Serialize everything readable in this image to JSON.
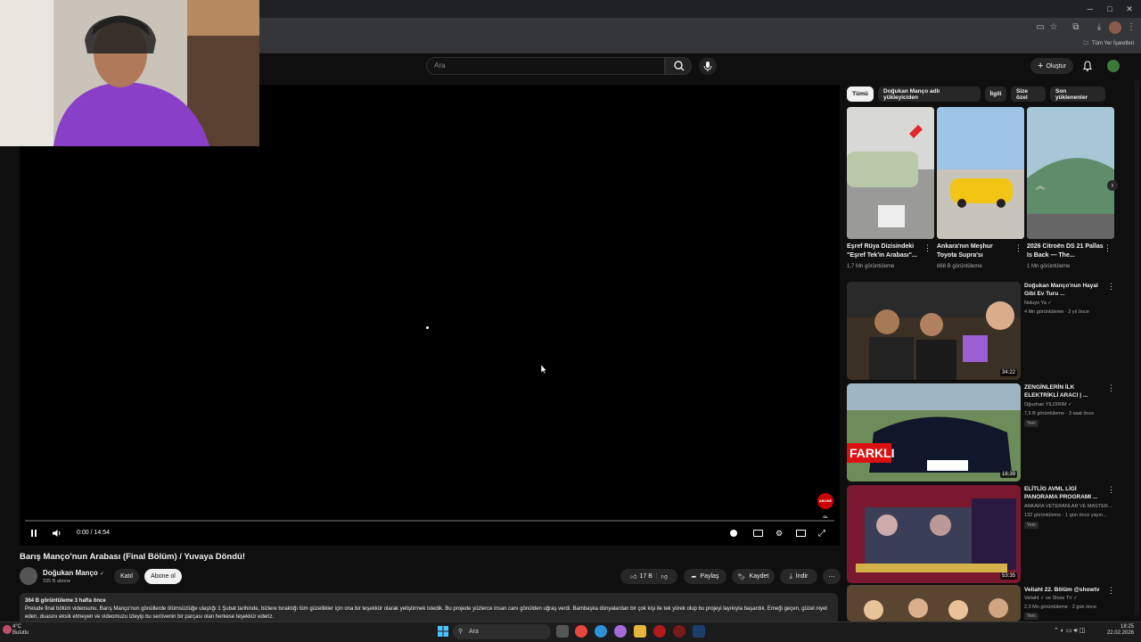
{
  "browser": {
    "bookmarks_label": "Tüm Yer İşaretleri"
  },
  "header": {
    "search_placeholder": "Ara",
    "create_label": "Oluştur"
  },
  "player": {
    "time": "0:00 / 14:54",
    "progress": 0,
    "badge": "ABONE OL"
  },
  "video": {
    "title": "Barış Manço'nun Arabası (Final Bölüm) / Yuvaya Döndü!",
    "channel": "Doğukan Manço",
    "subscribers": "335 B abone",
    "join_label": "Katıl",
    "subscribe_label": "Abone ol",
    "likes": "17 B",
    "share_label": "Paylaş",
    "save_label": "Kaydet",
    "download_label": "İndir",
    "desc_stats": "364 B görüntüleme  3 hafta önce",
    "desc_text": "Prelude final bölüm videosunu, Barış Manço'nun gönüllerde ölümsüzlüğe ulaştığı 1 Şubat tarihinde,  bizlere bıraktığı tüm güzellikler için ona bir teşekkür olarak yetiştirmek istedik. Bu projede yüzlerce insan canı gönülden uğraş verdi. Bambaşka dünyalardan bir çok  kişi ile tek yürek olup bu projeyi layıkıyla başardık. Emeği geçen, güzel niyet eden, duasını eksik etmeyen ve videomuzu izleyip bu serüvenin bir parçası olan herkese teşekkür ederiz."
  },
  "chips": [
    "Tümü",
    "Doğukan Manço adlı yükleyiciden",
    "İlgili",
    "Size özel",
    "Son yüklenenler"
  ],
  "shelf": [
    {
      "title": "Eşref Rüya Dizisindeki \"Eşref Tek'in Arabası\"...",
      "meta": "1,7 Mn görüntüleme"
    },
    {
      "title": "Ankara'nın Meşhur Toyota Supra'sı",
      "meta": "868 B görüntüleme"
    },
    {
      "title": "2026 Citroën DS 21 Pallas Is Back — The...",
      "meta": "1 Mn görüntüleme"
    }
  ],
  "recommendations": [
    {
      "title": "Doğukan Manço'nun Hayal Gibi Ev Turu ...",
      "channel": "Noluyo Ya ✓",
      "meta": "4 Mn görüntüleme · 2 yıl önce",
      "duration": "34:22",
      "new": ""
    },
    {
      "title": "ZENGİNLERİN İLK ELEKTRİKLİ ARACI | ...",
      "channel": "Oğuzhan YILDIRIM ✓",
      "meta": "7,5 B görüntüleme · 3 saat önce",
      "duration": "16:39",
      "new": "Yeni"
    },
    {
      "title": "ELİTLİG AVML LİGİ PANORAMA PROGRAMI ...",
      "channel": "ANKARA VETERANLAR VE MASTER...",
      "meta": "132 görüntüleme · 1 gün önce yayın...",
      "duration": "53:35",
      "new": "Yeni"
    },
    {
      "title": "Veliaht 22. Bölüm @showtv",
      "channel": "Veliaht ✓ ve Show TV ✓",
      "meta": "2,3 Mn görüntüleme · 2 gün önce",
      "duration": "",
      "new": "Yeni"
    }
  ],
  "taskbar": {
    "weather_temp": "4°C",
    "weather_desc": "Bulutlu",
    "search_label": "Ara",
    "time": "18:25",
    "date": "22.02.2026"
  }
}
